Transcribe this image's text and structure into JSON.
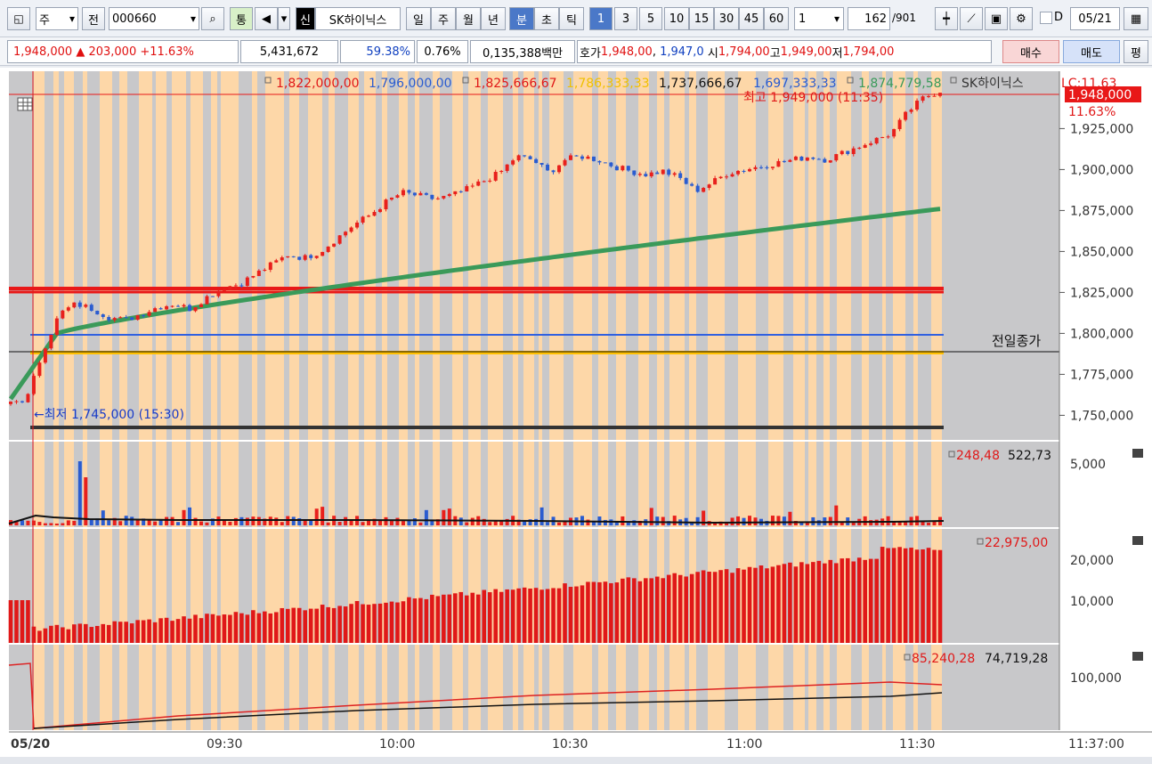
{
  "toolbar": {
    "type_label": "주",
    "prev_label": "전",
    "code": "000660",
    "tong_label": "통",
    "sin_label": "신",
    "stock_name": "SK하이닉스",
    "periods": [
      "일",
      "주",
      "월",
      "년",
      "분",
      "초",
      "틱"
    ],
    "active_period": "분",
    "intervals": [
      "1",
      "3",
      "5",
      "10",
      "15",
      "30",
      "45",
      "60"
    ],
    "active_interval": "1",
    "count_value": "1",
    "bar_count": "162",
    "bar_total": "/901",
    "date_check_label": "D",
    "date": "05/21"
  },
  "quote": {
    "price": "1,948,000",
    "change_arrow": "▲",
    "change": "203,000",
    "change_pct": "+11.63%",
    "volume": "5,431,672",
    "ratio": "59.38%",
    "turnover": "0.76%",
    "amount": "0,135,388백만",
    "hoga_label": "호가",
    "ask": "1,948,00",
    "bid": "1,947,0",
    "open_label": "시",
    "open": "1,794,00",
    "high_label": "고",
    "high": "1,949,00",
    "low_label": "저",
    "low": "1,794,00",
    "buy_label": "매수",
    "sell_label": "매도",
    "eval_label": "평"
  },
  "legend": {
    "v1": "1,822,000,00",
    "v2": "1,796,000,00",
    "v3": "1,825,666,67",
    "v4": "1,786,333,33",
    "v5": "1,737,666,67",
    "v6": "1,697,333,33",
    "v7": "1,874,779,58",
    "stock_name": "SK하이닉스",
    "lc": "LC:11.63"
  },
  "price_tag": "1,948,000",
  "pct_tag": "11.63%",
  "high_annot": "최고 1,949,000 (11:35)",
  "low_annot": "←최저 1,745,000 (15:30)",
  "prev_close_label": "전일종가",
  "price_ticks": [
    "1,925,000",
    "1,900,000",
    "1,875,000",
    "1,850,000",
    "1,825,000",
    "1,800,000",
    "1,775,000",
    "1,750,000"
  ],
  "vol_panel": {
    "v1": "248,48",
    "v2": "522,73",
    "tick": "5,000"
  },
  "p3_panel": {
    "v1": "22,975,00",
    "ticks": [
      "20,000",
      "10,000"
    ]
  },
  "p4_panel": {
    "v1": "85,240,28",
    "v2": "74,719,28",
    "tick": "100,000"
  },
  "time_labels": [
    "05/20",
    "09:30",
    "10:00",
    "10:30",
    "11:00",
    "11:30"
  ],
  "clock": "11:37:00",
  "colors": {
    "up": "#e8201c",
    "down": "#2a5cd0",
    "ma": "#3a9a5a",
    "shade": "#fdd7a8"
  },
  "chart_data": {
    "type": "line",
    "price_range": [
      1735000,
      1960000
    ],
    "close_approx": [
      1758000,
      1760000,
      1790000,
      1812000,
      1818000,
      1815000,
      1810000,
      1808000,
      1812000,
      1816000,
      1818000,
      1815000,
      1822000,
      1828000,
      1830000,
      1836000,
      1842000,
      1848000,
      1846000,
      1850000,
      1858000,
      1866000,
      1872000,
      1880000,
      1886000,
      1884000,
      1882000,
      1884000,
      1888000,
      1893000,
      1898000,
      1908000,
      1906000,
      1898000,
      1906000,
      1908000,
      1906000,
      1902000,
      1899000,
      1897000,
      1899000,
      1895000,
      1887000,
      1892000,
      1898000,
      1900000,
      1902000,
      1904000,
      1906000,
      1908000,
      1906000,
      1910000,
      1914000,
      1918000,
      1922000,
      1935000,
      1944000,
      1948000
    ],
    "lines": {
      "red_band": 1826000,
      "blue": 1796000,
      "yellow": 1786000,
      "black": 1745000
    }
  }
}
